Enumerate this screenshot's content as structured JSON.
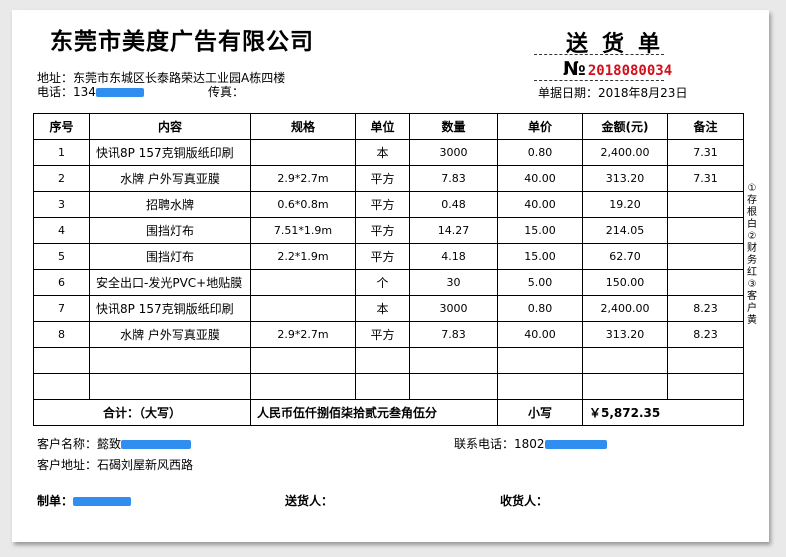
{
  "company": "东莞市美度广告有限公司",
  "doc_title": "送货单",
  "order_no": {
    "prefix": "№",
    "value": "2018080034"
  },
  "address": "地址：东莞市东城区长泰路荣达工业园A栋四楼",
  "phone_label": "电话：134",
  "fax_label": "传真：",
  "date": "单据日期：2018年8月23日",
  "table": {
    "headers": [
      "序号",
      "内容",
      "规格",
      "单位",
      "数量",
      "单价",
      "金额(元)",
      "备注"
    ],
    "rows": [
      [
        "1",
        "快讯8P 157克铜版纸印刷",
        "",
        "本",
        "3000",
        "0.80",
        "2,400.00",
        "7.31"
      ],
      [
        "2",
        "水牌 户外写真亚膜",
        "2.9*2.7m",
        "平方",
        "7.83",
        "40.00",
        "313.20",
        "7.31"
      ],
      [
        "3",
        "招聘水牌",
        "0.6*0.8m",
        "平方",
        "0.48",
        "40.00",
        "19.20",
        ""
      ],
      [
        "4",
        "围挡灯布",
        "7.51*1.9m",
        "平方",
        "14.27",
        "15.00",
        "214.05",
        ""
      ],
      [
        "5",
        "围挡灯布",
        "2.2*1.9m",
        "平方",
        "4.18",
        "15.00",
        "62.70",
        ""
      ],
      [
        "6",
        "安全出口-发光PVC+地贴膜",
        "",
        "个",
        "30",
        "5.00",
        "150.00",
        ""
      ],
      [
        "7",
        "快讯8P 157克铜版纸印刷",
        "",
        "本",
        "3000",
        "0.80",
        "2,400.00",
        "8.23"
      ],
      [
        "8",
        "水牌 户外写真亚膜",
        "2.9*2.7m",
        "平方",
        "7.83",
        "40.00",
        "313.20",
        "8.23"
      ],
      [
        "",
        "",
        "",
        "",
        "",
        "",
        "",
        ""
      ],
      [
        "",
        "",
        "",
        "",
        "",
        "",
        "",
        ""
      ]
    ],
    "total_label": "合计：（大写）",
    "total_words": "人民币伍仟捌佰柒拾贰元叁角伍分",
    "small_label": "小写",
    "small_value": "￥5,872.35"
  },
  "side_note": "①存根白②财务红③客户黄",
  "customer_name_label": "客户名称：懿致",
  "contact_label": "联系电话：1802",
  "customer_address": "客户地址：石碣刘屋新风西路",
  "signatures": {
    "maker": "制单：",
    "deliverer": "送货人：",
    "receiver": "收货人："
  },
  "redaction_color": "#2f8ef0",
  "order_no_color": "#d0101a"
}
